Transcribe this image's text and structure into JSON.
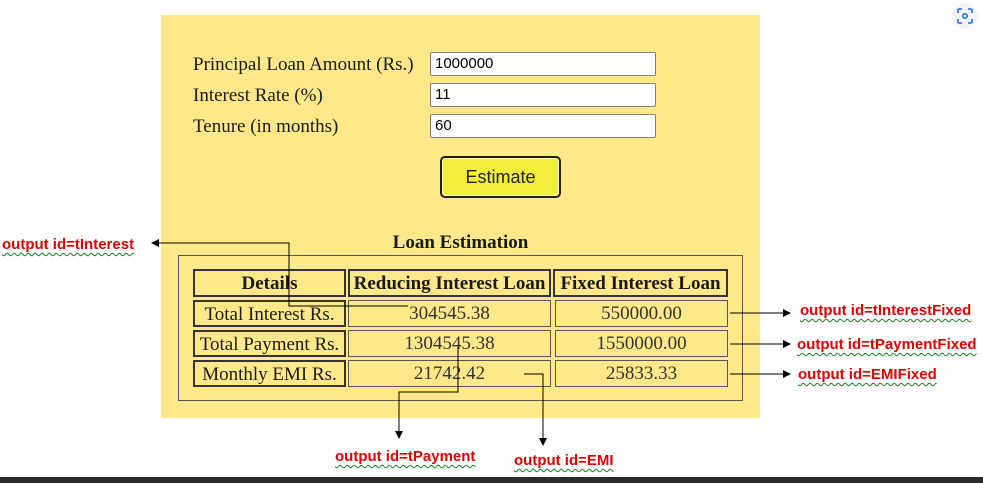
{
  "form": {
    "principal_label": "Principal Loan Amount (Rs.)",
    "principal_value": "1000000",
    "rate_label": "Interest Rate (%)",
    "rate_value": "11",
    "tenure_label": "Tenure (in months)",
    "tenure_value": "60",
    "estimate_button": "Estimate"
  },
  "estimation": {
    "title": "Loan Estimation",
    "headers": [
      "Details",
      "Reducing Interest Loan",
      "Fixed Interest Loan"
    ],
    "rows": [
      {
        "label": "Total Interest Rs.",
        "reducing": "304545.38",
        "fixed": "550000.00"
      },
      {
        "label": "Total Payment Rs.",
        "reducing": "1304545.38",
        "fixed": "1550000.00"
      },
      {
        "label": "Monthly EMI Rs.",
        "reducing": "21742.42",
        "fixed": "25833.33"
      }
    ]
  },
  "annotations": {
    "tInterest": "output id=tInterest",
    "tInterestFixed": "output id=tInterestFixed",
    "tPaymentFixed": "output id=tPaymentFixed",
    "EMIFixed": "output id=EMIFixed",
    "tPayment": "output id=tPayment",
    "EMI": "output id=EMI"
  },
  "icons": {
    "screenshot": "screenshot-icon"
  },
  "colors": {
    "panel_bg": "#ffe88a",
    "button_bg": "#f1ef3a",
    "annotation_text": "#e00000"
  }
}
